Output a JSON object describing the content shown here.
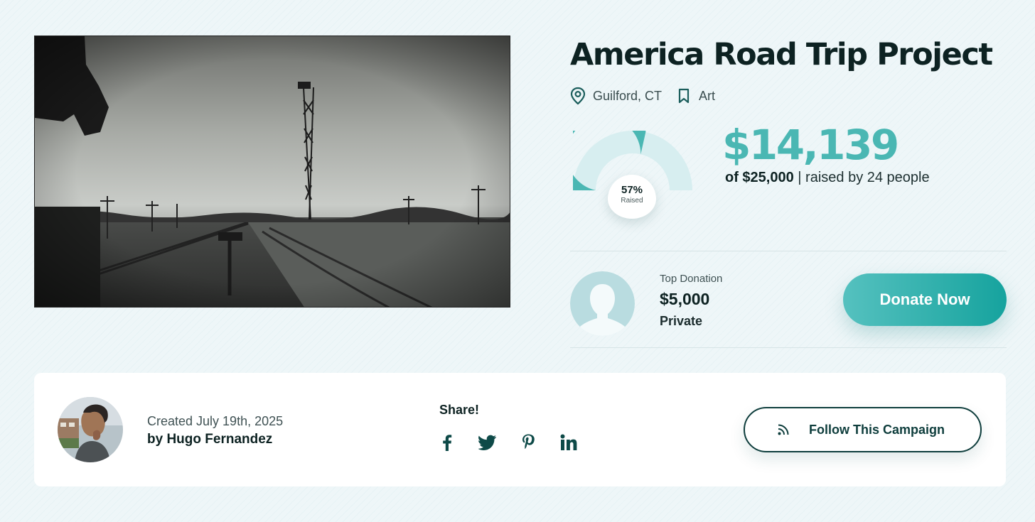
{
  "campaign": {
    "title": "America Road Trip Project",
    "location": "Guilford, CT",
    "category": "Art",
    "location_icon": "location-pin-icon",
    "category_icon": "bookmark-icon"
  },
  "progress": {
    "percent_value": 0.57,
    "percent_label": "57%",
    "raised_label": "Raised",
    "amount": "$14,139",
    "goal": "of $25,000",
    "raised_by": "| raised by 24 people"
  },
  "top_donation": {
    "label": "Top Donation",
    "amount": "$5,000",
    "donor": "Private",
    "avatar_icon": "default-avatar-icon"
  },
  "donate_button": {
    "label": "Donate Now"
  },
  "creator": {
    "created": "Created July 19th, 2025",
    "by": "by Hugo Fernandez"
  },
  "share": {
    "label": "Share!",
    "networks": [
      "facebook-icon",
      "twitter-icon",
      "pinterest-icon",
      "linkedin-icon"
    ]
  },
  "follow_button": {
    "label": "Follow This Campaign",
    "icon": "rss-icon"
  },
  "colors": {
    "accent": "#4ab7b3",
    "gauge_fill": "#4ab7b3",
    "gauge_track": "#d7eef0",
    "dark": "#0d2222",
    "background": "#eef6f8"
  }
}
